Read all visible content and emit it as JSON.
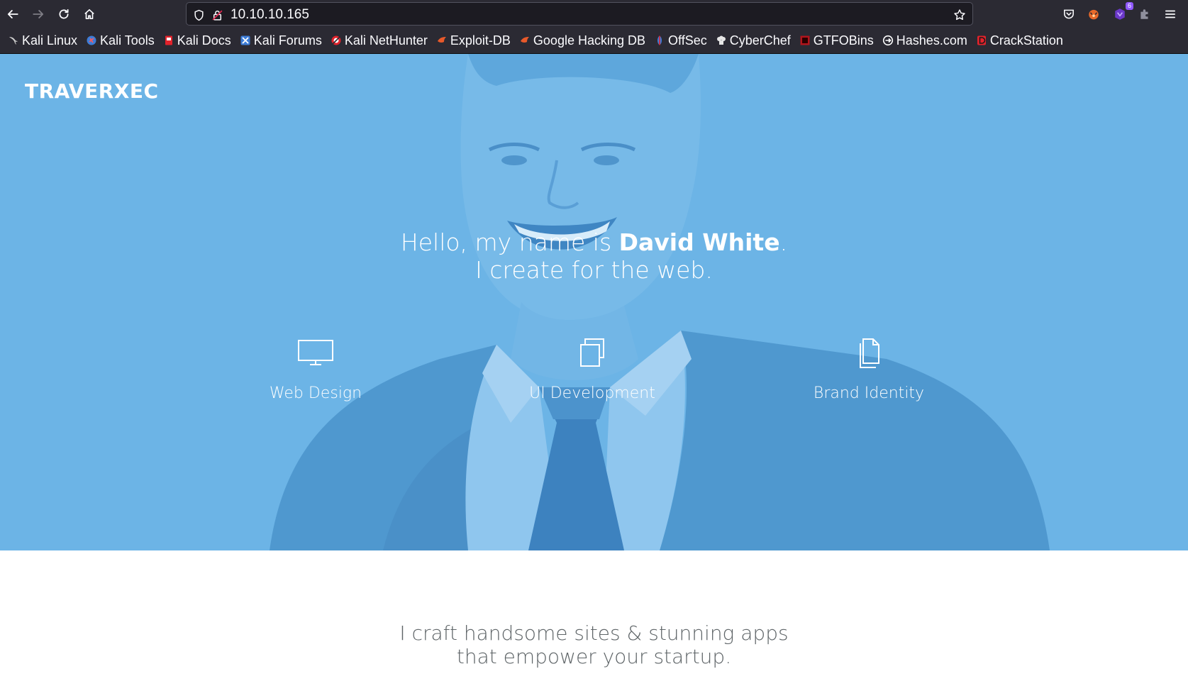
{
  "browser": {
    "url": "10.10.10.165",
    "extension_badge": "6",
    "bookmarks": [
      {
        "label": "Kali Linux",
        "icon": "kali-dragon-icon",
        "color": "#ffffff"
      },
      {
        "label": "Kali Tools",
        "icon": "kali-tools-icon",
        "color": "#3d7dd8"
      },
      {
        "label": "Kali Docs",
        "icon": "kali-docs-icon",
        "color": "#e3222b"
      },
      {
        "label": "Kali Forums",
        "icon": "kali-forums-icon",
        "color": "#3d7dd8"
      },
      {
        "label": "Kali NetHunter",
        "icon": "kali-nethunter-icon",
        "color": "#e3222b"
      },
      {
        "label": "Exploit-DB",
        "icon": "exploit-db-icon",
        "color": "#e8592a"
      },
      {
        "label": "Google Hacking DB",
        "icon": "ghdb-icon",
        "color": "#e8592a"
      },
      {
        "label": "OffSec",
        "icon": "offsec-icon",
        "color": "#3d7dd8"
      },
      {
        "label": "CyberChef",
        "icon": "cyberchef-icon",
        "color": "#e0e0e0"
      },
      {
        "label": "GTFOBins",
        "icon": "gtfobins-icon",
        "color": "#b3141b"
      },
      {
        "label": "Hashes.com",
        "icon": "hashes-icon",
        "color": "#ffffff"
      },
      {
        "label": "CrackStation",
        "icon": "crackstation-icon",
        "color": "#e3222b"
      }
    ]
  },
  "page": {
    "brand": "TRAVERXEC",
    "headline": {
      "prefix": "Hello, my name is ",
      "name": "David White",
      "suffix": ".",
      "line2": "I create for the web."
    },
    "services": [
      {
        "label": "Web Design",
        "icon": "monitor-icon"
      },
      {
        "label": "UI Development",
        "icon": "layers-icon"
      },
      {
        "label": "Brand Identity",
        "icon": "documents-icon"
      }
    ],
    "tagline": {
      "line1": "I craft handsome sites & stunning apps",
      "line2": "that empower your startup."
    },
    "colors": {
      "hero_overlay": "#6cb4e6",
      "chrome_bg": "#2b2a33",
      "tagline_text": "#5e6467"
    }
  }
}
